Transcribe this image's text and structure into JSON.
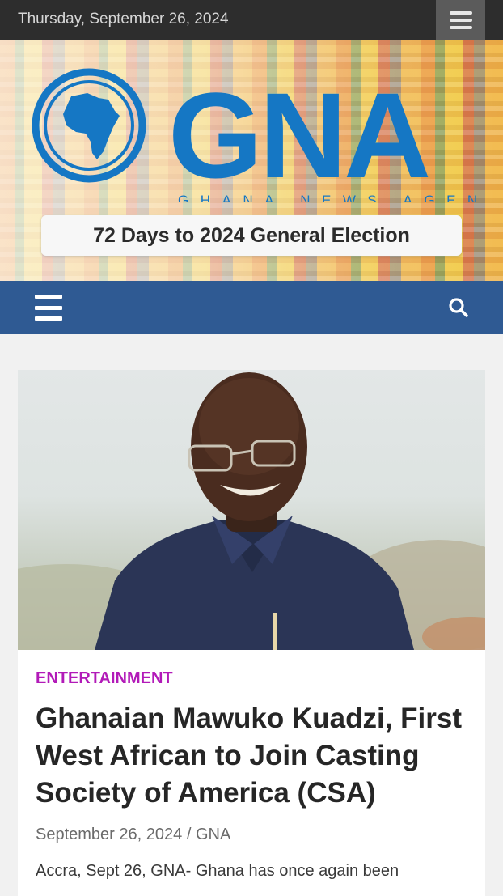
{
  "topbar": {
    "date": "Thursday, September 26, 2024",
    "menu_icon": "hamburger-icon"
  },
  "header": {
    "logo_text": "GNA",
    "logo_tagline": "GHANA NEWS AGENCY",
    "countdown": "72 Days to 2024 General Election",
    "brand_color": "#1577c4"
  },
  "navbar": {
    "menu_icon": "hamburger-icon",
    "search_icon": "search-icon",
    "color": "#2f5a93"
  },
  "article": {
    "category": "ENTERTAINMENT",
    "category_color": "#b21ab8",
    "title": "Ghanaian Mawuko Kuadzi, First West African to Join Casting Society of America (CSA)",
    "date": "September 26, 2024",
    "separator": "/",
    "author": "GNA",
    "excerpt": "Accra, Sept 26, GNA- Ghana has once again been"
  }
}
